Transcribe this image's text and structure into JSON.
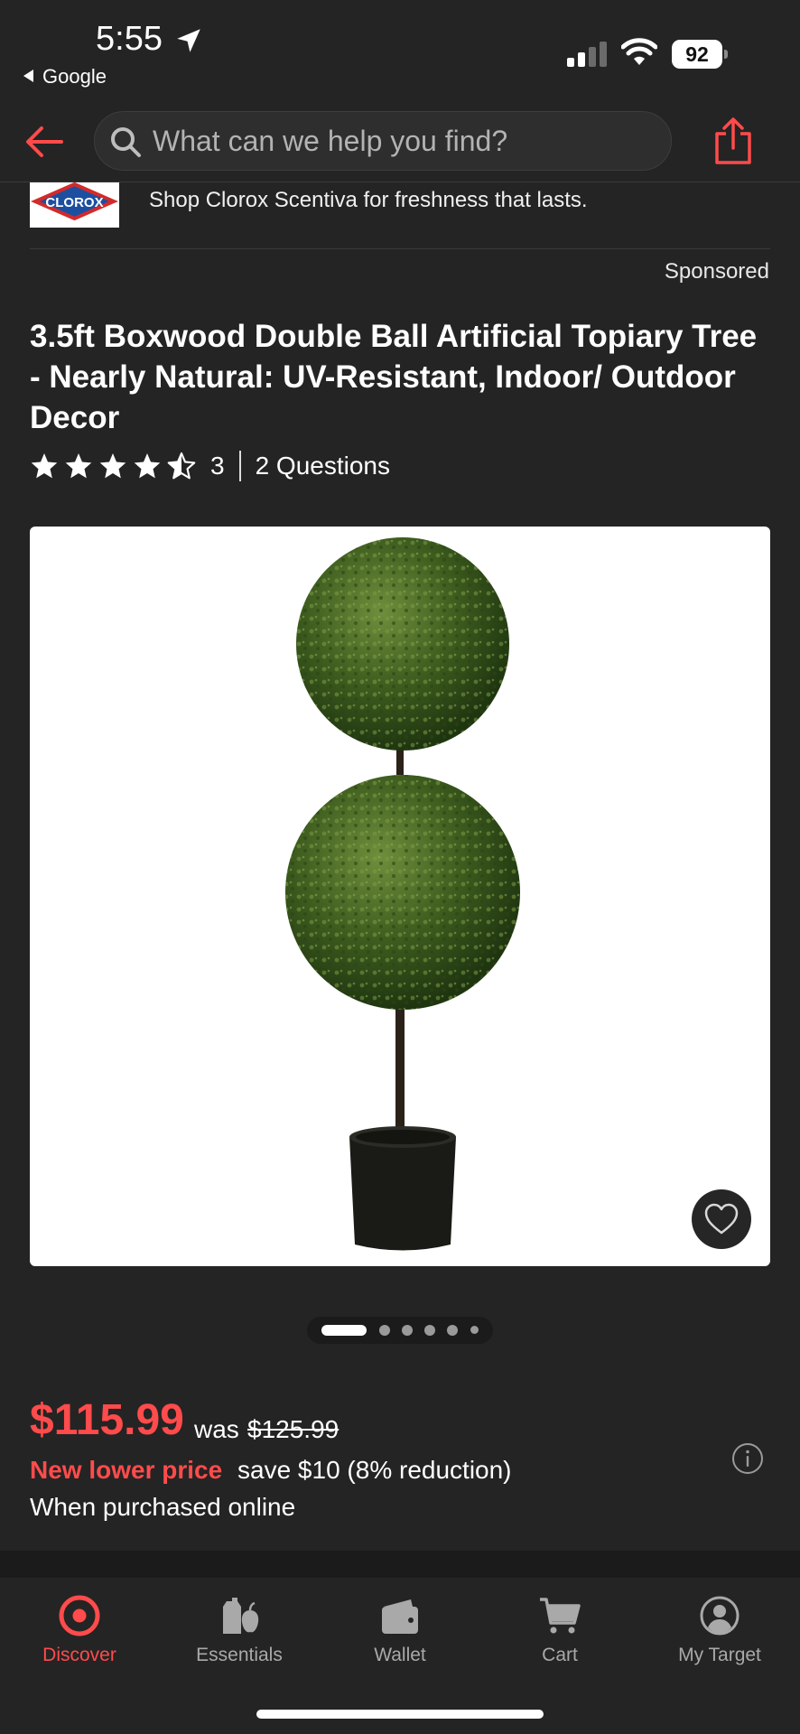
{
  "status_bar": {
    "time": "5:55",
    "back_app": "Google",
    "battery": "92"
  },
  "header": {
    "search_placeholder": "What can we help you find?"
  },
  "banner": {
    "logo_text": "CLOROX",
    "text": "Shop Clorox Scentiva for freshness that lasts.",
    "sponsored": "Sponsored"
  },
  "product": {
    "title": "3.5ft Boxwood Double Ball Artificial Topiary Tree - Nearly Natural: UV-Resistant, Indoor/ Outdoor Decor",
    "rating": 4.5,
    "rating_count": "3",
    "questions": "2 Questions",
    "carousel": {
      "count": 6,
      "active": 0
    }
  },
  "price": {
    "current": "$115.99",
    "was_label": "was",
    "was_price": "$125.99",
    "new_lower": "New lower price",
    "save_text": "save $10 (8% reduction)",
    "purchased": "When purchased online"
  },
  "colors": {
    "accent": "#ff4b4b",
    "background": "#242424"
  },
  "bottom_nav": [
    {
      "label": "Discover",
      "icon": "target-icon",
      "active": true
    },
    {
      "label": "Essentials",
      "icon": "essentials-icon",
      "active": false
    },
    {
      "label": "Wallet",
      "icon": "wallet-icon",
      "active": false
    },
    {
      "label": "Cart",
      "icon": "cart-icon",
      "active": false
    },
    {
      "label": "My Target",
      "icon": "profile-icon",
      "active": false
    }
  ]
}
